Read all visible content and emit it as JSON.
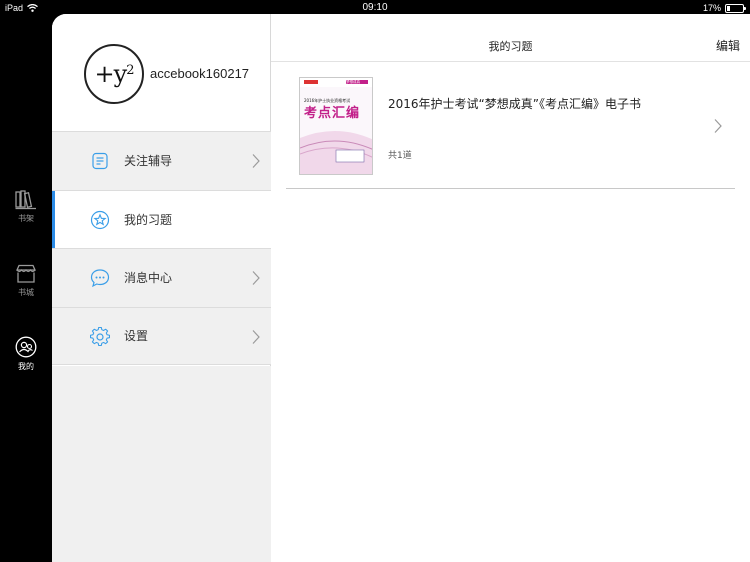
{
  "status_bar": {
    "device": "iPad",
    "time": "09:10",
    "battery_percent": "17%",
    "battery_level": 0.17
  },
  "tab_bar": {
    "items": [
      {
        "label": "书架",
        "icon": "bookshelf-icon",
        "active": false
      },
      {
        "label": "书城",
        "icon": "store-icon",
        "active": false
      },
      {
        "label": "我的",
        "icon": "profile-icon",
        "active": true
      }
    ]
  },
  "profile": {
    "username": "accebook160217",
    "avatar_text": "+y",
    "avatar_sup": "2"
  },
  "menu": {
    "items": [
      {
        "label": "关注辅导",
        "icon": "notes-icon",
        "active": false
      },
      {
        "label": "我的习题",
        "icon": "star-icon",
        "active": true
      },
      {
        "label": "消息中心",
        "icon": "chat-bubble-icon",
        "active": false
      },
      {
        "label": "设置",
        "icon": "gear-icon",
        "active": false
      }
    ]
  },
  "content": {
    "title": "我的习题",
    "edit_label": "编辑",
    "books": [
      {
        "title": "2016年护士考试“梦想成真”《考点汇编》电子书",
        "count": "共1道",
        "cover_heading": "考点汇编",
        "cover_subtitle": "2016年护士执业资格考试",
        "cover_brand": "梦想成真"
      }
    ]
  },
  "colors": {
    "accent": "#2b8be6",
    "sidebar_bg": "#f0f0f0",
    "icon_blue": "#3a9ee8",
    "cover_pink": "#c2208a"
  }
}
